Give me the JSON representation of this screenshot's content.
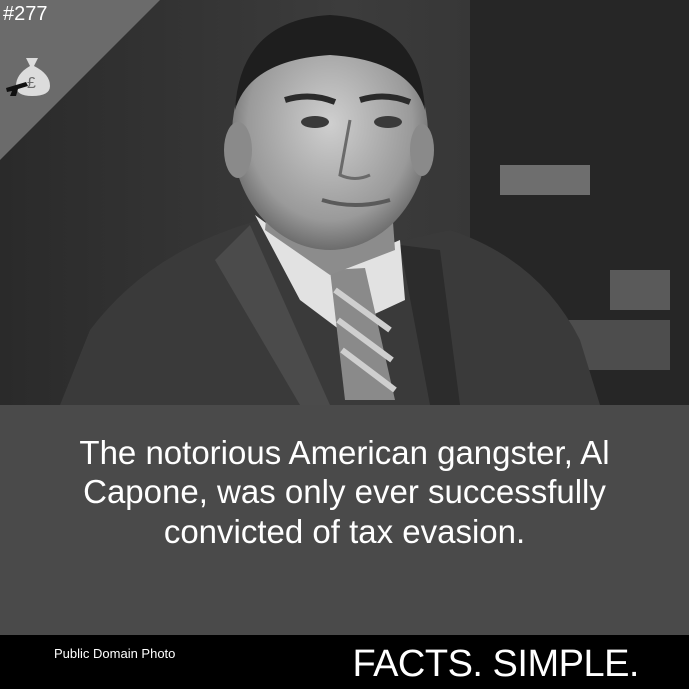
{
  "badge": {
    "number": "#277",
    "icon": "money-bag-gun-icon"
  },
  "photo": {
    "subject": "portrait-photo"
  },
  "caption": {
    "text": "The notorious American gangster, Al Capone, was only ever successfully convicted of tax evasion."
  },
  "footer": {
    "credit": "Public Domain Photo",
    "brand": "FACTS. SIMPLE."
  },
  "colors": {
    "panel": "#4a4a4a",
    "footer": "#000000",
    "corner": "#6b6b6b",
    "text": "#ffffff"
  }
}
